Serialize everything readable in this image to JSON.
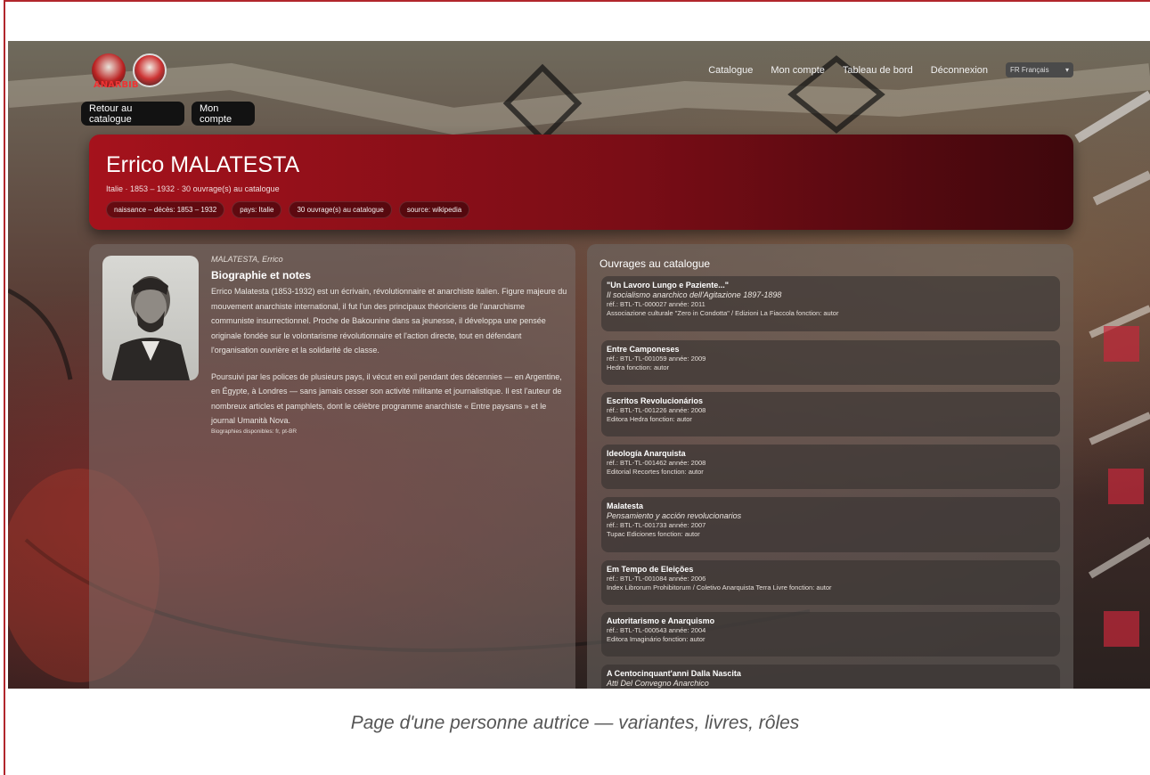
{
  "header": {
    "logo_text": "ANARBIB",
    "nav": [
      "Catalogue",
      "Mon compte",
      "Tableau de bord",
      "Déconnexion"
    ],
    "language": "FR Français",
    "buttons": {
      "back": "Retour au catalogue",
      "account": "Mon compte"
    }
  },
  "author": {
    "name": "Errico MALATESTA",
    "subtitle": "Italie · 1853 – 1932 · 30 ouvrage(s) au catalogue",
    "chips": [
      "naissance – décès: 1853 – 1932",
      "pays: Italie",
      "30 ouvrage(s) au catalogue",
      "source: wikipedia"
    ]
  },
  "bio": {
    "variant": "MALATESTA, Errico",
    "title": "Biographie et notes",
    "paragraph1": "Errico Malatesta (1853-1932) est un écrivain, révolutionnaire et anarchiste italien. Figure majeure du mouvement anarchiste international, il fut l'un des principaux théoriciens de l'anarchisme communiste insurrectionnel. Proche de Bakounine dans sa jeunesse, il développa une pensée originale fondée sur le volontarisme révolutionnaire et l'action directe, tout en défendant l'organisation ouvrière et la solidarité de classe.",
    "paragraph2": "Poursuivi par les polices de plusieurs pays, il vécut en exil pendant des décennies — en Argentine, en Égypte, à Londres — sans jamais cesser son activité militante et journalistique. Il est l'auteur de nombreux articles et pamphlets, dont le célèbre programme anarchiste « Entre paysans » et le journal Umanità Nova.",
    "available": "Biographies disponibles: fr, pt-BR"
  },
  "works": {
    "title": "Ouvrages au catalogue",
    "items": [
      {
        "title": "\"Un Lavoro Lungo e Paziente...\"",
        "subtitle": "Il socialismo anarchico dell'Agitazione 1897-1898",
        "ref": "réf.: BTL-TL-000027   année: 2011",
        "publisher": "Associazione culturale \"Zero in Condotta\" / Edizioni La Fiaccola   fonction: autor"
      },
      {
        "title": "Entre Camponeses",
        "subtitle": "",
        "ref": "réf.: BTL-TL-001059   année: 2009",
        "publisher": "Hedra   fonction: autor"
      },
      {
        "title": "Escritos Revolucionários",
        "subtitle": "",
        "ref": "réf.: BTL-TL-001226   année: 2008",
        "publisher": "Editora Hedra   fonction: autor"
      },
      {
        "title": "Ideología Anarquista",
        "subtitle": "",
        "ref": "réf.: BTL-TL-001462   année: 2008",
        "publisher": "Editorial Recortes   fonction: autor"
      },
      {
        "title": "Malatesta",
        "subtitle": "Pensamiento y acción revolucionarios",
        "ref": "réf.: BTL-TL-001733   année: 2007",
        "publisher": "Tupac Ediciones   fonction: autor"
      },
      {
        "title": "Em Tempo de Eleições",
        "subtitle": "",
        "ref": "réf.: BTL-TL-001084   année: 2006",
        "publisher": "Index Librorum Prohibitorum / Coletivo Anarquista Terra Livre   fonction: autor"
      },
      {
        "title": "Autoritarismo e Anarquismo",
        "subtitle": "",
        "ref": "réf.: BTL-TL-000543   année: 2004",
        "publisher": "Editora Imaginário   fonction: autor"
      },
      {
        "title": "A Centocinquant'anni Dalla Nascita",
        "subtitle": "Atti Del Convegno Anarchico",
        "ref": "",
        "publisher": ""
      }
    ]
  },
  "caption": "Page d'une personne autrice — variantes, livres, rôles"
}
